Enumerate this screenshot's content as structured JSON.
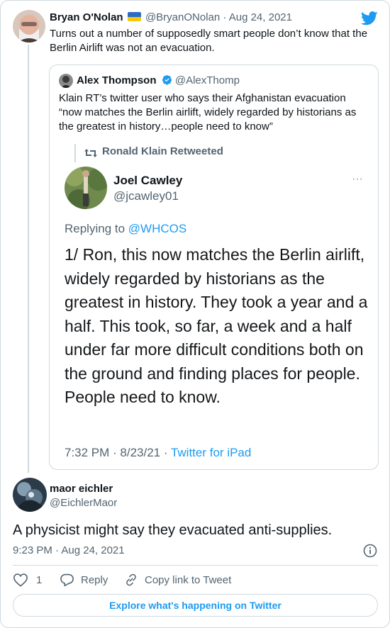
{
  "tweet": {
    "author_name": "Bryan O'Nolan",
    "author_handle": "@BryanONolan",
    "separator": "·",
    "date": "Aug 24, 2021",
    "text": "Turns out a number of supposedly smart people don’t know that the Berlin Airlift was not an evacuation."
  },
  "quoted": {
    "author_name": "Alex Thompson",
    "author_handle": "@AlexThomp",
    "text": "Klain RT’s twitter user who says their Afghanistan evacuation “now matches the Berlin airlift, widely regarded by historians as the greatest in history…people need to know”"
  },
  "screenshot": {
    "retweet_label": "Ronald Klain Retweeted",
    "author_name": "Joel Cawley",
    "author_handle": "@jcawley01",
    "more": "···",
    "replying_to_label": "Replying to",
    "replying_to_handle": "@WHCOS",
    "text": "1/ Ron, this now matches the Berlin airlift, widely regarded by historians as the greatest in history. They took a year and a half. This took, so far, a week and a half under far more difficult conditions both on the ground and finding places for people. People need to know.",
    "timestamp": "7:32 PM · 8/23/21 ·",
    "source": "Twitter for iPad"
  },
  "reply": {
    "author_name": "maor eichler",
    "author_handle": "@EichlerMaor",
    "text": "A physicist might say they evacuated anti-supplies.",
    "time": "9:23 PM · Aug 24, 2021"
  },
  "actions": {
    "like_count": "1",
    "reply_label": "Reply",
    "copy_link_label": "Copy link to Tweet"
  },
  "explore_label": "Explore what's happening on Twitter",
  "colors": {
    "accent": "#1d9bf0",
    "text": "#0f1419",
    "muted": "#536471",
    "border": "#cfd9de",
    "flag_blue": "#2b6cc4",
    "flag_yellow": "#f6c90e"
  }
}
